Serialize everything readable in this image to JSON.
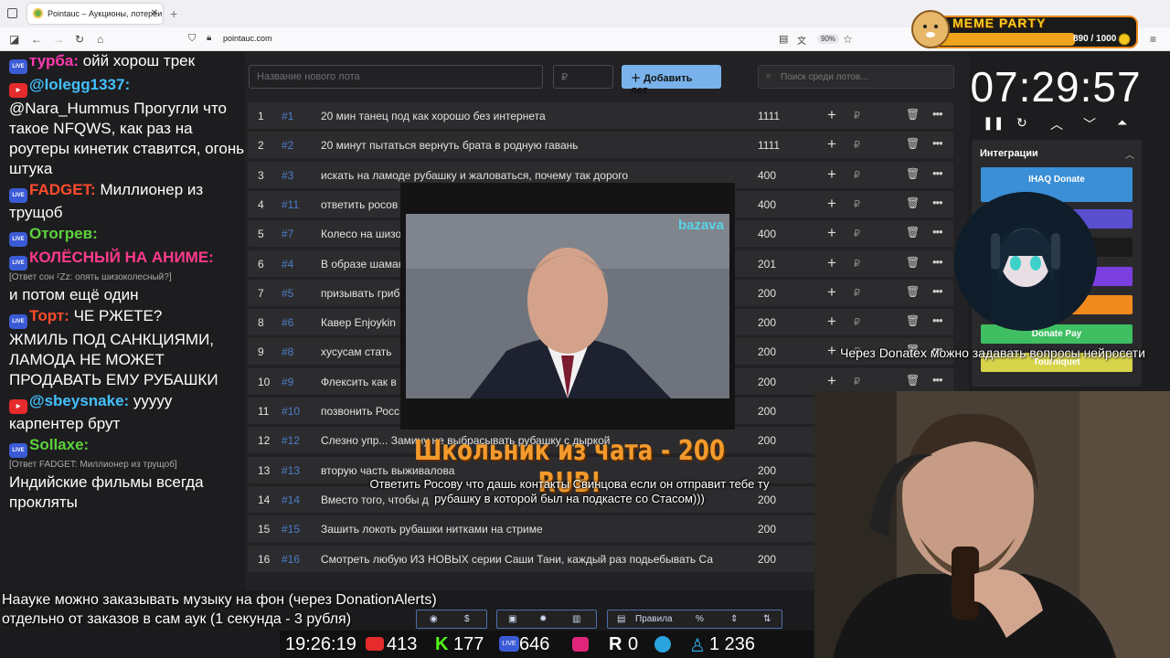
{
  "browser": {
    "tab_title": "Pointauc – Аукционы, лотереи",
    "url": "pointauc.com",
    "zoom": "90%"
  },
  "chat": [
    {
      "badge": "live",
      "nick": "турба:",
      "nick_color": "#ff3ab0",
      "text": " ойй хорош трек"
    },
    {
      "badge": "yt",
      "nick": "@lolegg1337:",
      "nick_color": "#43c0ff",
      "text": ""
    },
    {
      "badge": "",
      "nick": "",
      "nick_color": "#fff",
      "text": "@Nara_Hummus Прогугли что такое NFQWS, как раз на роутеры кинетик ставится, огонь штука"
    },
    {
      "badge": "live",
      "nick": "FADGET:",
      "nick_color": "#ff4b2b",
      "text": " Миллионер из трущоб"
    },
    {
      "badge": "live",
      "nick": "Отогрев:",
      "nick_color": "#5cd23b",
      "text": ""
    },
    {
      "badge": "live",
      "nick": "КОЛЁСНЫЙ НА АНИМЕ:",
      "nick_color": "#ff3a8c",
      "text": "",
      "reply": "[Ответ сон ᶻZz: опять шизоколесный?]"
    },
    {
      "badge": "",
      "nick": "",
      "nick_color": "#fff",
      "text": "и потом ещё один"
    },
    {
      "badge": "live",
      "nick": "Торт:",
      "nick_color": "#ff4b2b",
      "text": " ЧЕ РЖЕТЕ?"
    },
    {
      "badge": "",
      "nick": "",
      "nick_color": "#fff",
      "text": "ЖМИЛЬ ПОД САНКЦИЯМИ, ЛАМОДА НЕ МОЖЕТ ПРОДАВАТЬ ЕМУ РУБАШКИ"
    },
    {
      "badge": "yt",
      "nick": "@sbeysnake:",
      "nick_color": "#43c0ff",
      "text": " ууууу карпентер брут"
    },
    {
      "badge": "live",
      "nick": "Sollaxe:",
      "nick_color": "#5cd23b",
      "text": "",
      "reply": "[Ответ FADGET: Миллионер из трущоб]"
    },
    {
      "badge": "",
      "nick": "",
      "nick_color": "#fff",
      "text": "Индийские фильмы всегда прокляты"
    }
  ],
  "auction": {
    "new_lot_placeholder": "Название нового лота",
    "amount_placeholder": "₽",
    "add_button": "Добавить лот",
    "search_placeholder": "Поиск среди лотов...",
    "currency": "₽",
    "lots": [
      {
        "n": "1",
        "id": "#1",
        "name": "20 мин танец под как хорошо без интернета",
        "amount": "1111"
      },
      {
        "n": "2",
        "id": "#2",
        "name": "20 минут пытаться вернуть брата в родную гавань",
        "amount": "1111"
      },
      {
        "n": "3",
        "id": "#3",
        "name": "искать на ламоде рубашку и жаловаться, почему так дорого",
        "amount": "400"
      },
      {
        "n": "4",
        "id": "#11",
        "name": "ответить росов",
        "amount": "400"
      },
      {
        "n": "5",
        "id": "#7",
        "name": "Колесо на шизо",
        "amount": "400"
      },
      {
        "n": "6",
        "id": "#4",
        "name": "В образе шаман",
        "amount": "201"
      },
      {
        "n": "7",
        "id": "#5",
        "name": "призывать гриб",
        "amount": "200"
      },
      {
        "n": "8",
        "id": "#6",
        "name": "Кавер Enjoykin",
        "amount": "200"
      },
      {
        "n": "9",
        "id": "#8",
        "name": "хусусам стать",
        "amount": "200"
      },
      {
        "n": "10",
        "id": "#9",
        "name": "Флексить как в",
        "amount": "200"
      },
      {
        "n": "11",
        "id": "#10",
        "name": "позвонить Росс",
        "amount": "200"
      },
      {
        "n": "12",
        "id": "#12",
        "name": "Слезно упр... Замину не выбрасывать рубашку с дыркой",
        "amount": "200"
      },
      {
        "n": "13",
        "id": "#13",
        "name": "вторую часть выживалова",
        "amount": "200"
      },
      {
        "n": "14",
        "id": "#14",
        "name": "Вместо того, чтобы д",
        "amount": "200"
      },
      {
        "n": "15",
        "id": "#15",
        "name": "Зашить локоть рубашки нитками на стриме",
        "amount": "200"
      },
      {
        "n": "16",
        "id": "#16",
        "name": "Смотреть любую ИЗ НОВЫХ серии Саши Тани, каждый раз подьебывать Са",
        "amount": "200"
      }
    ]
  },
  "timer": "07:29:57",
  "integrations": {
    "title": "Интеграции",
    "buttons": [
      {
        "label": "IHAQ Donate",
        "color": "#3a8fd6"
      },
      {
        "label": "",
        "color": "#5a4fcf"
      },
      {
        "label": "",
        "color": "#1a1a1a"
      },
      {
        "label": "",
        "color": "#7b3fe0"
      },
      {
        "label": "Alerts",
        "color": "#f08a1c"
      },
      {
        "label": "Donate Pay",
        "color": "#3fbf62"
      },
      {
        "label": "Tourniquet",
        "color": "#d7d44a"
      }
    ]
  },
  "overlay": {
    "alert_title": "Школьник из чата - 200 RUB!",
    "alert_text": "Ответить Росову что дашь контакты Свинцова если он отправит тебе ту рубашку в которой был на подкасте со Стасом)))",
    "video_watermark": "bazava",
    "meme_party_label": "MEME PARTY",
    "meme_party_score": "890 / 1000",
    "ticker": "Через Donatex можно задавать вопросы нейросети",
    "bottom_note_1": "Наауке можно заказывать музыку на фон (через DonationAlerts)",
    "bottom_note_2": "отдельно от заказов в сам аук (1 секунда - 3 рубля)"
  },
  "bottombar": {
    "rules_label": "Правила"
  },
  "stats": {
    "clock": "19:26:19",
    "youtube": "413",
    "kick": "177",
    "vkplay": "646",
    "rutube": "0",
    "r": "0",
    "telegram": "",
    "total": "1 236"
  }
}
